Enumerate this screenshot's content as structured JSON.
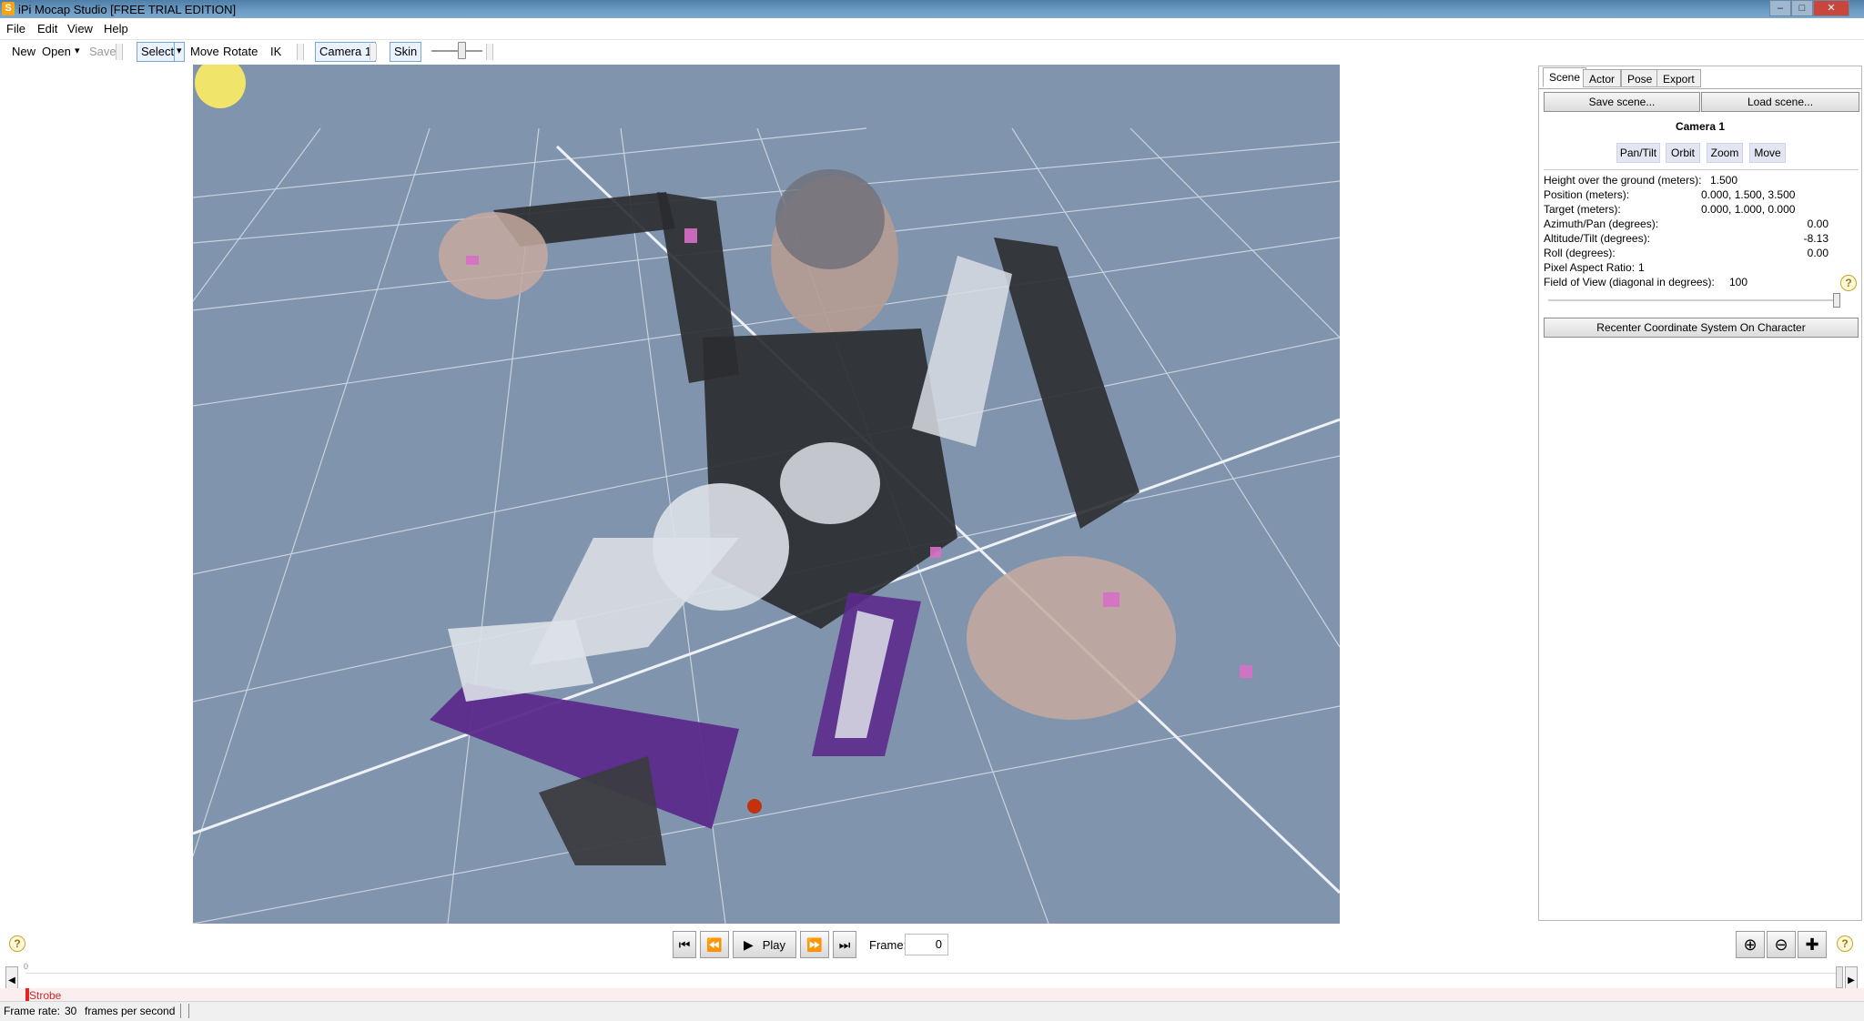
{
  "window": {
    "title": "iPi Mocap Studio [FREE TRIAL EDITION]",
    "icon_letter": "S",
    "buttons": {
      "minimize": "–",
      "maximize": "□",
      "close": "✕"
    }
  },
  "menu": [
    "File",
    "Edit",
    "View",
    "Help"
  ],
  "toolbar": {
    "new_label": "New",
    "open_label": "Open",
    "open_dropdown": "▾",
    "save_label": "Save",
    "select_label": "Select",
    "select_dropdown": "▾",
    "move_label": "Move",
    "rotate_label": "Rotate",
    "ik_label": "IK",
    "camera_label": "Camera 1",
    "skin_label": "Skin"
  },
  "panel": {
    "tabs": [
      "Scene",
      "Actor",
      "Pose",
      "Export"
    ],
    "active_tab": "Scene",
    "save_scene": "Save scene...",
    "load_scene": "Load scene...",
    "camera_title": "Camera 1",
    "camera_modes": [
      "Pan/Tilt",
      "Orbit",
      "Zoom",
      "Move"
    ],
    "props": {
      "height_label": "Height over the ground (meters):",
      "height_value": "1.500",
      "position_label": "Position (meters):",
      "position_value": "0.000, 1.500, 3.500",
      "target_label": "Target (meters):",
      "target_value": "0.000, 1.000, 0.000",
      "azimuth_label": "Azimuth/Pan (degrees):",
      "azimuth_value": "0.00",
      "altitude_label": "Altitude/Tilt (degrees):",
      "altitude_value": "-8.13",
      "roll_label": "Roll (degrees):",
      "roll_value": "0.00",
      "aspect_label": "Pixel Aspect Ratio:",
      "aspect_value": "1",
      "fov_label": "Field of View (diagonal in degrees):",
      "fov_value": "100"
    },
    "recenter": "Recenter Coordinate System On Character",
    "help_glyph": "?"
  },
  "playback": {
    "first": "⏮",
    "prev": "⏪",
    "play_icon": "▶",
    "play_label": "Play",
    "next": "⏩",
    "last": "⏭",
    "frame_label": "Frame:",
    "frame_value": "0",
    "zoom_in": "⊕",
    "zoom_out": "⊖",
    "fit": "✚"
  },
  "timeline": {
    "zero_tick": "0",
    "strobe_label": "Strobe",
    "left_arrow": "◀",
    "right_arrow": "▶"
  },
  "status": {
    "frame_rate_label": "Frame rate:",
    "frame_rate_value": "30",
    "frame_rate_unit": "frames per second"
  },
  "colors": {
    "viewport_bg": "#8094ad",
    "accent": "#7aa6d6",
    "strobe": "#d42a2a"
  }
}
